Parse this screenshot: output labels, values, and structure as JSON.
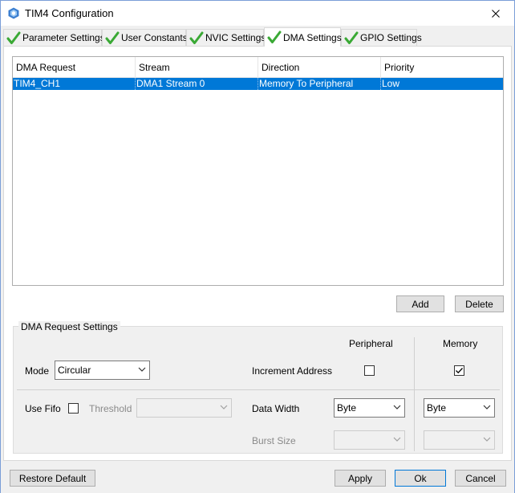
{
  "window": {
    "title": "TIM4 Configuration",
    "icon": "cube-app-icon",
    "close_icon": "close-icon"
  },
  "tabs": [
    {
      "label": "Parameter Settings",
      "icon": "check-icon",
      "active": false
    },
    {
      "label": "User Constants",
      "icon": "check-icon",
      "active": false
    },
    {
      "label": "NVIC Settings",
      "icon": "check-icon",
      "active": false
    },
    {
      "label": "DMA Settings",
      "icon": "check-icon",
      "active": true
    },
    {
      "label": "GPIO Settings",
      "icon": "check-icon",
      "active": false
    }
  ],
  "dma_table": {
    "columns": [
      "DMA Request",
      "Stream",
      "Direction",
      "Priority"
    ],
    "rows": [
      {
        "request": "TIM4_CH1",
        "stream": "DMA1 Stream 0",
        "direction": "Memory To Peripheral",
        "priority": "Low",
        "selected": true
      }
    ]
  },
  "table_buttons": {
    "add": "Add",
    "delete": "Delete"
  },
  "request_settings": {
    "group_title": "DMA Request Settings",
    "peripheral_header": "Peripheral",
    "memory_header": "Memory",
    "mode_label": "Mode",
    "mode_value": "Circular",
    "increment_address_label": "Increment Address",
    "peripheral_increment": false,
    "memory_increment": true,
    "use_fifo_label": "Use Fifo",
    "use_fifo": false,
    "threshold_label": "Threshold",
    "threshold_value": "",
    "data_width_label": "Data Width",
    "peripheral_data_width": "Byte",
    "memory_data_width": "Byte",
    "burst_size_label": "Burst Size",
    "peripheral_burst_size": "",
    "memory_burst_size": ""
  },
  "footer": {
    "restore_default": "Restore Default",
    "apply": "Apply",
    "ok": "Ok",
    "cancel": "Cancel"
  },
  "colors": {
    "selection": "#0078d7",
    "check_green": "#3aa935",
    "window_bg": "#f0f0f0"
  }
}
